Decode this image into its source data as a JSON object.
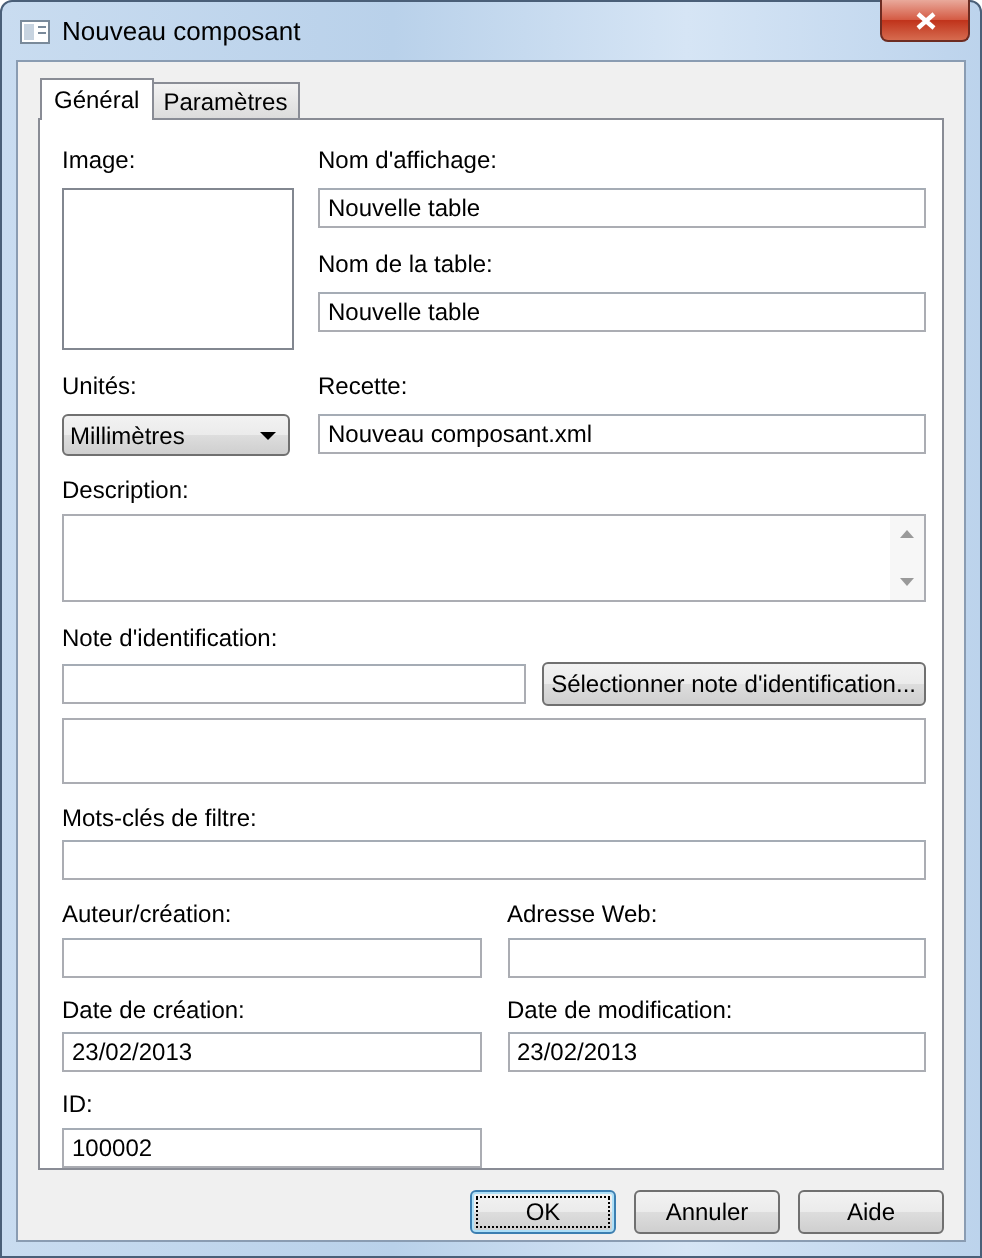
{
  "window": {
    "title": "Nouveau composant"
  },
  "tabs": [
    {
      "label": "Général",
      "selected": true
    },
    {
      "label": "Paramètres",
      "selected": false
    }
  ],
  "image": {
    "label": "Image:"
  },
  "display_name": {
    "label": "Nom d'affichage:",
    "value": "Nouvelle table"
  },
  "table_name": {
    "label": "Nom de la table:",
    "value": "Nouvelle table"
  },
  "units": {
    "label": "Unités:",
    "value": "Millimètres"
  },
  "recipe": {
    "label": "Recette:",
    "value": "Nouveau composant.xml"
  },
  "description": {
    "label": "Description:"
  },
  "id_note": {
    "label": "Note d'identification:",
    "button": "Sélectionner note d'identification..."
  },
  "filter_keywords": {
    "label": "Mots-clés de filtre:"
  },
  "author": {
    "label": "Auteur/création:"
  },
  "web_address": {
    "label": "Adresse Web:"
  },
  "creation_date": {
    "label": "Date de création:",
    "value": "23/02/2013"
  },
  "modification_date": {
    "label": "Date de modification:",
    "value": "23/02/2013"
  },
  "id": {
    "label": "ID:",
    "value": "100002"
  },
  "buttons": [
    {
      "label": "OK",
      "default": true
    },
    {
      "label": "Annuler",
      "default": false
    },
    {
      "label": "Aide",
      "default": false
    }
  ]
}
